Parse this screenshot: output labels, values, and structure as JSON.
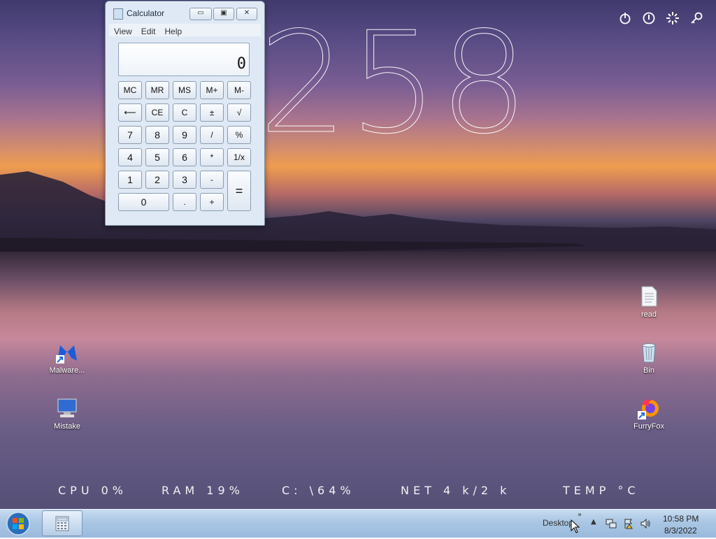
{
  "desktop": {
    "clock_digits": "258",
    "top_right_icons": [
      "power-icon",
      "info-icon",
      "loading-icon",
      "key-icon"
    ]
  },
  "calculator": {
    "title": "Calculator",
    "menu": [
      "View",
      "Edit",
      "Help"
    ],
    "display_value": "0",
    "keys": {
      "row1": [
        "MC",
        "MR",
        "MS",
        "M+",
        "M-"
      ],
      "row2": [
        "⟵",
        "CE",
        "C",
        "±",
        "√"
      ],
      "row3": [
        "7",
        "8",
        "9",
        "/",
        "%"
      ],
      "row4": [
        "4",
        "5",
        "6",
        "*",
        "1/x"
      ],
      "row5": [
        "1",
        "2",
        "3",
        "-",
        "="
      ],
      "row6": [
        "0",
        ".",
        "+"
      ]
    }
  },
  "icons": {
    "malware": "Malware...",
    "mistake": "Mistake",
    "read": "read",
    "bin": "Bin",
    "furryfox": "FurryFox"
  },
  "stats": {
    "cpu": "CPU 0%",
    "ram": "RAM 19%",
    "disk": "C: \\64%",
    "net": "NET 4 k/2 k",
    "temp": "TEMP °C"
  },
  "taskbar": {
    "desktop_label": "Desktop",
    "time": "10:58 PM",
    "date": "8/3/2022"
  }
}
